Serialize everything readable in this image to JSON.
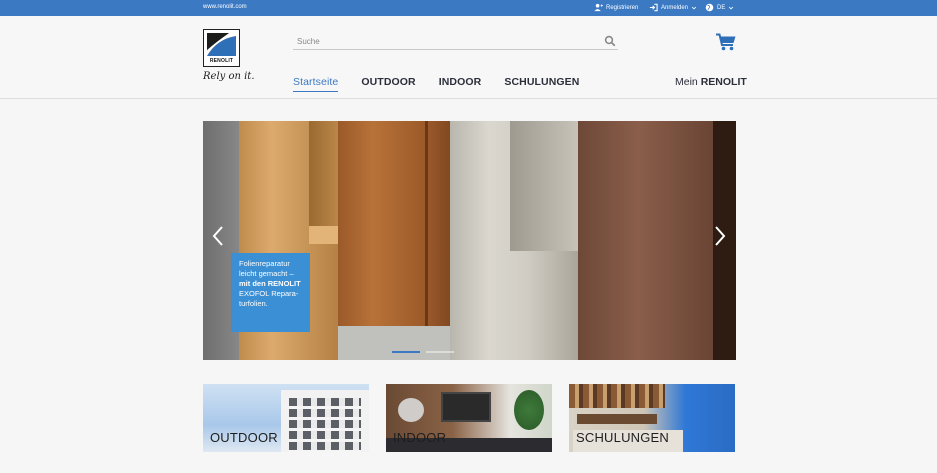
{
  "topbar": {
    "url": "www.renolit.com",
    "register": "Registrieren",
    "login": "Anmelden",
    "language": "DE"
  },
  "header": {
    "logo_text": "RENOLIT",
    "tagline": "Rely on it.",
    "search_placeholder": "Suche",
    "nav": [
      {
        "label": "Startseite",
        "active": true
      },
      {
        "label": "OUTDOOR"
      },
      {
        "label": "INDOOR"
      },
      {
        "label": "SCHULUNGEN"
      }
    ],
    "mein_prefix": "Mein",
    "mein_brand": "RENOLIT"
  },
  "slider": {
    "caption_lines": [
      "Folienreparatur",
      "leicht gemacht –",
      "mit den RENOLIT",
      "EXOFOL Repara-",
      "turfolien."
    ],
    "active_slide": 1,
    "slide_count": 2
  },
  "tiles": [
    {
      "label": "OUTDOOR"
    },
    {
      "label": "INDOOR"
    },
    {
      "label": "SCHULUNGEN"
    }
  ],
  "colors": {
    "brand_blue": "#3b79c3",
    "caption_blue": "#3b8fd4"
  },
  "icons": {
    "register": "user-plus-icon",
    "login": "sign-in-icon",
    "language": "globe-icon",
    "search": "search-icon",
    "cart": "cart-icon",
    "prev": "chevron-left-icon",
    "next": "chevron-right-icon"
  }
}
